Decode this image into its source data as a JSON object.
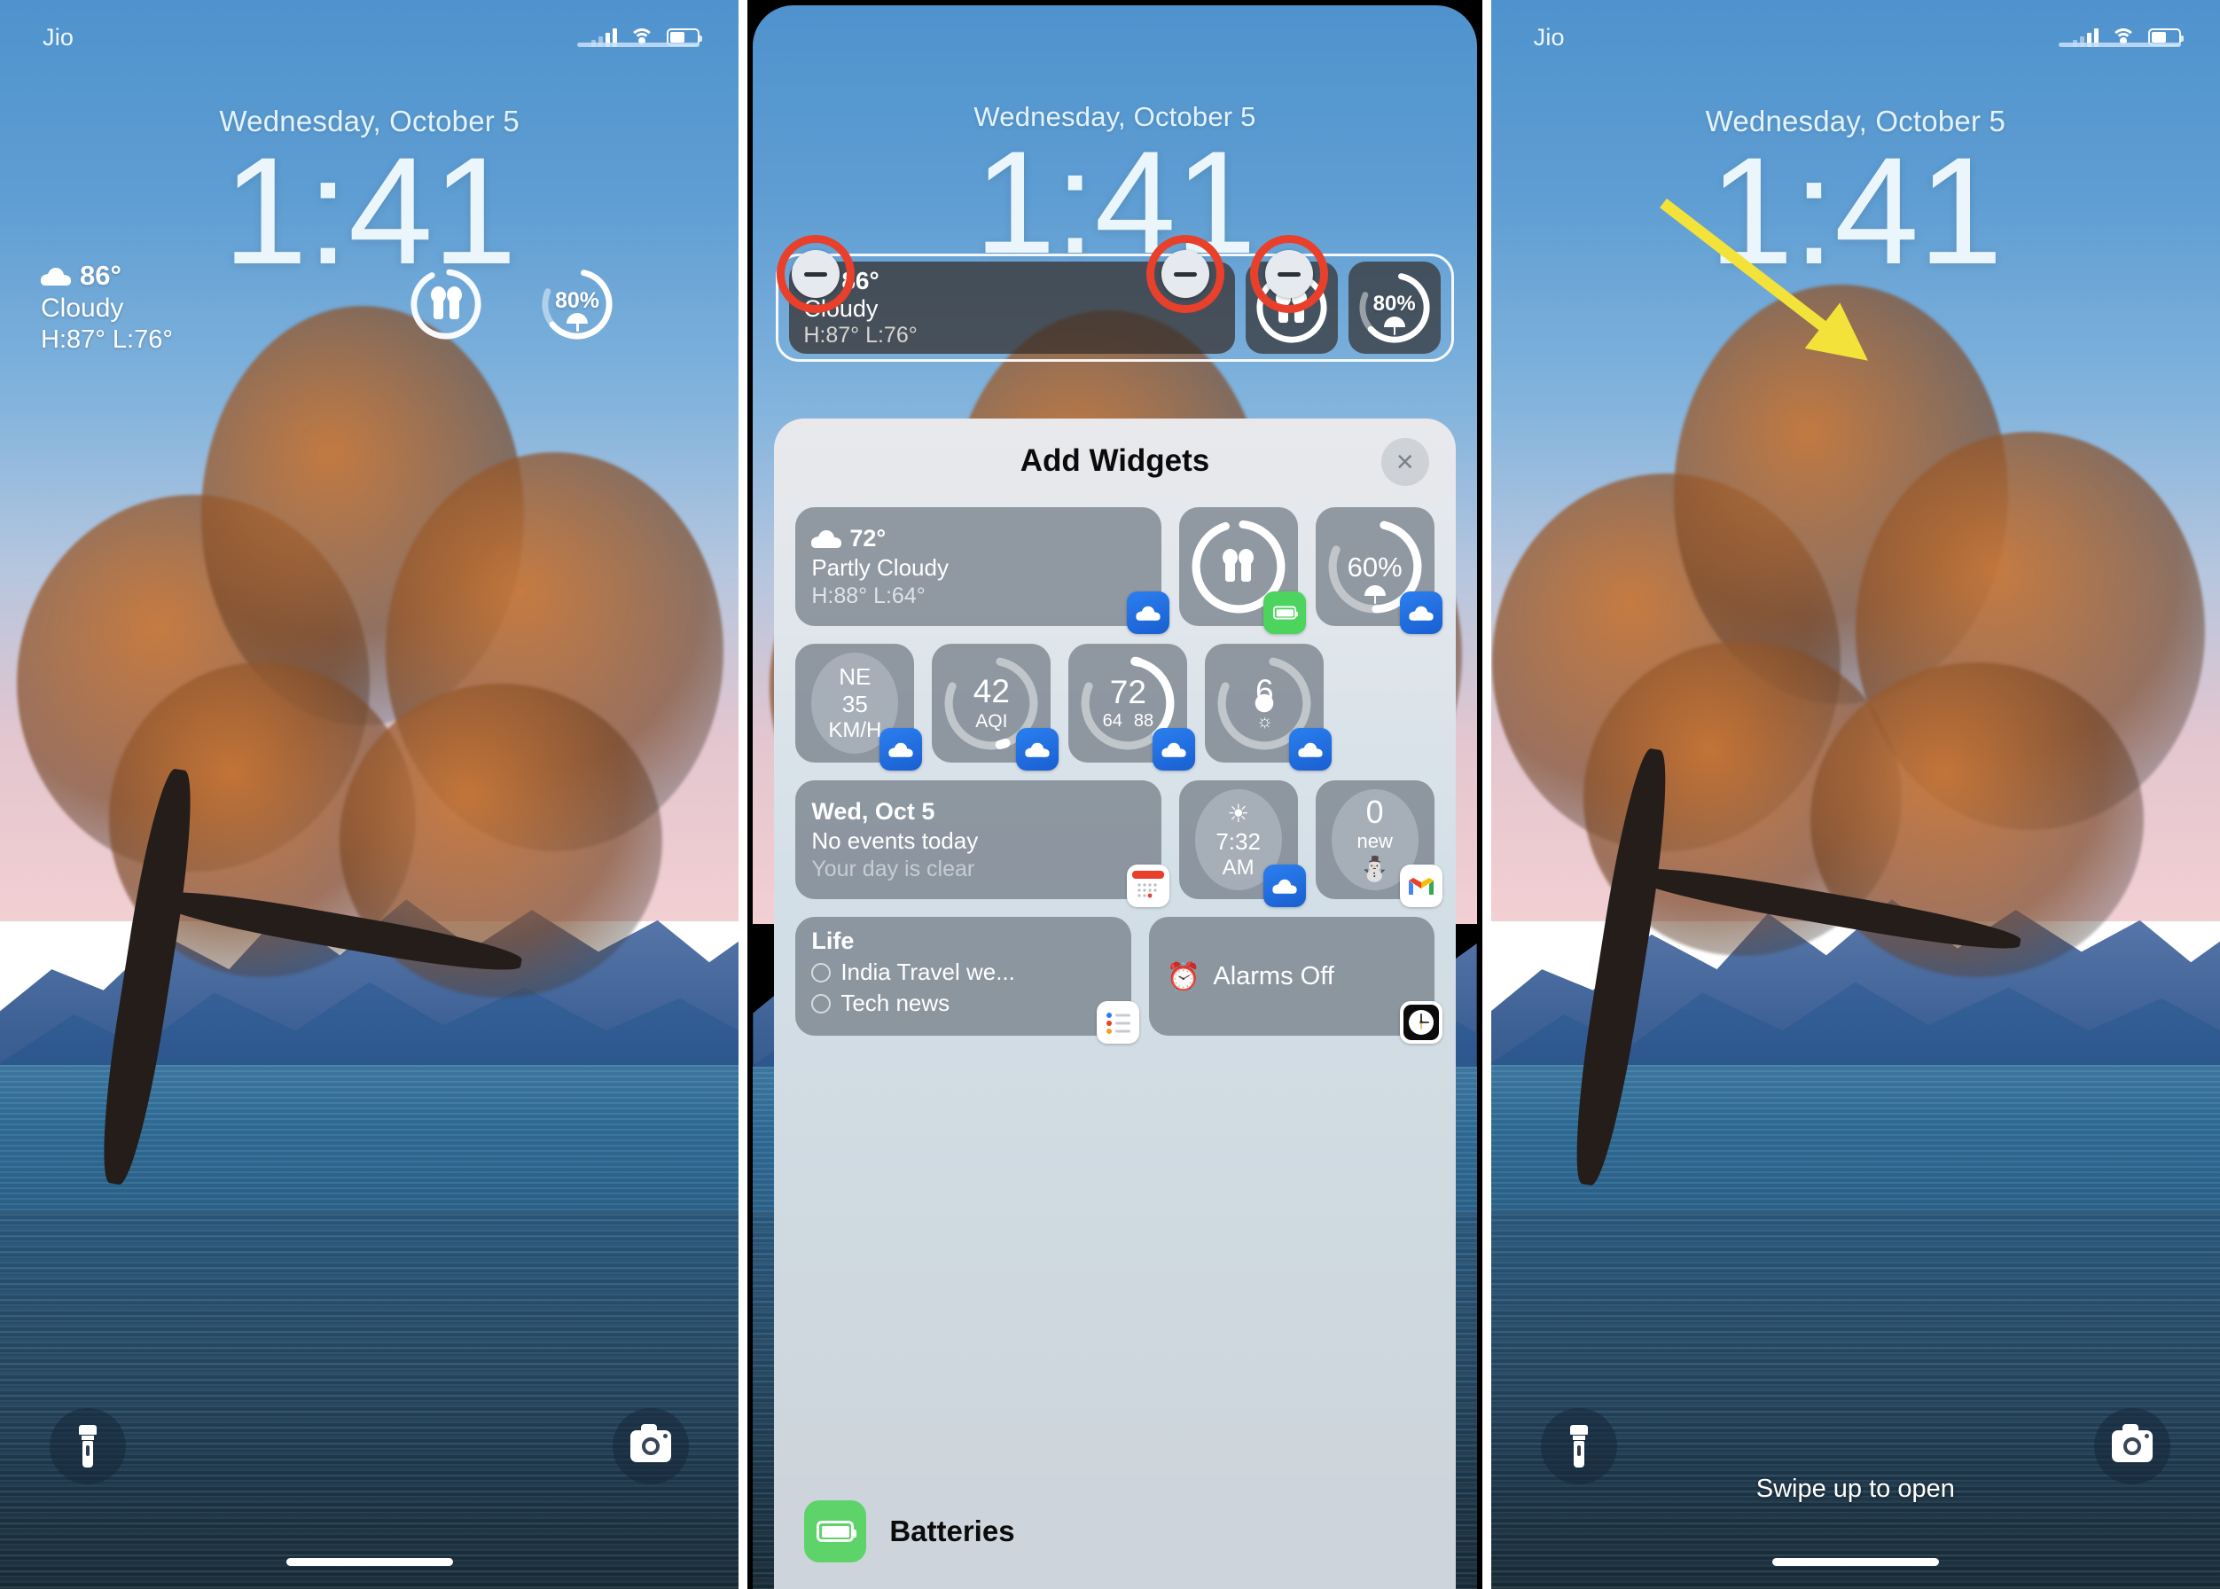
{
  "panels": {
    "left": {
      "status": {
        "carrier": "Jio",
        "signal_icon": "cellular-bars-icon",
        "wifi_icon": "wifi-icon",
        "battery_icon": "battery-icon"
      },
      "date": "Wednesday, October 5",
      "time": "1:41",
      "weather_widget": {
        "icon": "cloud-icon",
        "temp": "86°",
        "condition": "Cloudy",
        "highlow": "H:87° L:76°"
      },
      "ring_widgets": [
        {
          "name": "airpods-battery-ring",
          "icon": "airpods-icon",
          "label": "",
          "progress": 80
        },
        {
          "name": "rain-chance-ring",
          "icon": "umbrella-icon",
          "label": "80%",
          "progress": 78
        }
      ],
      "quick_actions": {
        "flashlight": "flashlight-icon",
        "camera": "camera-icon"
      }
    },
    "middle": {
      "date": "Wednesday, October 5",
      "time": "1:41",
      "edit_widgets": [
        {
          "name": "weather-widget",
          "icon": "cloud-icon",
          "temp": "86°",
          "condition": "Cloudy",
          "highlow": "H:87° L:76°",
          "remove_label": "−"
        },
        {
          "name": "airpods-battery-widget",
          "icon": "airpods-icon",
          "remove_label": "−"
        },
        {
          "name": "rain-chance-widget",
          "label": "80%",
          "icon": "umbrella-icon",
          "remove_label": "−"
        }
      ],
      "sheet": {
        "title": "Add Widgets",
        "close_label": "×",
        "rows": [
          [
            {
              "type": "text",
              "name": "weather-conditions-widget",
              "icon": "partly-cloudy-icon",
              "l1": "72°",
              "l2": "Partly Cloudy",
              "l3": "H:88° L:64°",
              "badge": "weather-app-icon",
              "badge_style": "badge-weather",
              "span": 2
            },
            {
              "type": "airpods",
              "name": "batteries-widget",
              "icon": "airpods-icon",
              "badge": "batteries-app-icon",
              "badge_style": "badge-green",
              "progress": 92
            },
            {
              "type": "ring",
              "name": "rain-chance-widget",
              "big": "60%",
              "icon": "umbrella-icon",
              "badge": "weather-app-icon",
              "badge_style": "badge-weather",
              "progress": 62
            }
          ],
          [
            {
              "type": "oval",
              "name": "wind-widget",
              "o1": "NE",
              "o2": "35",
              "o3": "KM/H",
              "badge": "weather-app-icon",
              "badge_style": "badge-weather"
            },
            {
              "type": "ring",
              "name": "air-quality-widget",
              "big": "42",
              "sub": "AQI",
              "badge": "weather-app-icon",
              "badge_style": "badge-weather",
              "progress": 22
            },
            {
              "type": "ring",
              "name": "temperature-range-widget",
              "big": "72",
              "sub2": [
                "64",
                "88"
              ],
              "badge": "weather-app-icon",
              "badge_style": "badge-weather",
              "progress": 58
            },
            {
              "type": "ring",
              "name": "uv-index-widget",
              "big": "6",
              "icon": "sun-icon",
              "badge": "weather-app-icon",
              "badge_style": "badge-weather",
              "progress": 96
            }
          ],
          [
            {
              "type": "text",
              "name": "calendar-widget",
              "l1": "Wed, Oct 5",
              "l2": "No events today",
              "l3": "Your day is clear",
              "badge": "calendar-app-icon",
              "badge_style": "badge-white",
              "span": 2
            },
            {
              "type": "oval",
              "name": "sunrise-widget",
              "icon": "sunrise-icon",
              "o2": "7:32",
              "o3": "AM",
              "badge": "weather-app-icon",
              "badge_style": "badge-weather"
            },
            {
              "type": "oval",
              "name": "gmail-widget",
              "num": "0",
              "new": "new",
              "icon": "gmail-m-icon",
              "badge": "gmail-app-icon",
              "badge_style": "badge-white"
            }
          ],
          [
            {
              "type": "reminders",
              "name": "reminders-widget",
              "l1": "Life",
              "items": [
                "India Travel we...",
                "Tech news"
              ],
              "badge": "reminders-app-icon",
              "badge_style": "badge-white",
              "span": 2
            },
            {
              "type": "alarm",
              "name": "alarm-widget",
              "icon": "alarm-clock-icon",
              "label": "Alarms Off",
              "badge": "clock-app-icon",
              "badge_style": "badge-white",
              "span": 2
            }
          ]
        ],
        "footer": {
          "icon": "batteries-app-icon",
          "label": "Batteries"
        }
      }
    },
    "right": {
      "status": {
        "carrier": "Jio",
        "signal_icon": "cellular-bars-icon",
        "wifi_icon": "wifi-icon",
        "battery_icon": "battery-icon"
      },
      "date": "Wednesday, October 5",
      "time": "1:41",
      "swipe_hint": "Swipe up to open",
      "annotation": {
        "type": "arrow",
        "color": "#f2e23a",
        "name": "yellow-arrow-annotation"
      },
      "quick_actions": {
        "flashlight": "flashlight-icon",
        "camera": "camera-icon"
      }
    }
  },
  "colors": {
    "annotation_red": "#e8402a",
    "annotation_yellow": "#f2e23a",
    "badge_green": "#4cd45f"
  }
}
